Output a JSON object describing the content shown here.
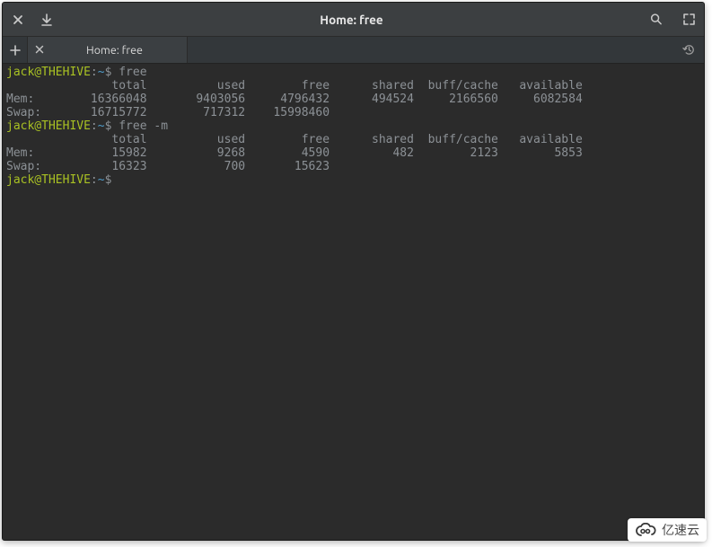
{
  "titlebar": {
    "title": "Home: free"
  },
  "tab": {
    "label": "Home: free"
  },
  "prompt": {
    "user_host": "jack@THEHIVE",
    "sep": ":",
    "path": "~",
    "symbol": "$"
  },
  "commands": {
    "cmd1": "free",
    "cmd2": "free -m"
  },
  "headers": {
    "total": "total",
    "used": "used",
    "free": "free",
    "shared": "shared",
    "buff_cache": "buff/cache",
    "available": "available"
  },
  "labels": {
    "mem": "Mem:",
    "swap": "Swap:"
  },
  "free1": {
    "mem": {
      "total": "16366048",
      "used": "9403056",
      "free": "4796432",
      "shared": "494524",
      "buff_cache": "2166560",
      "available": "6082584"
    },
    "swap": {
      "total": "16715772",
      "used": "717312",
      "free": "15998460"
    }
  },
  "free2": {
    "mem": {
      "total": "15982",
      "used": "9268",
      "free": "4590",
      "shared": "482",
      "buff_cache": "2123",
      "available": "5853"
    },
    "swap": {
      "total": "16323",
      "used": "700",
      "free": "15623"
    }
  },
  "watermark": {
    "text": "亿速云"
  }
}
